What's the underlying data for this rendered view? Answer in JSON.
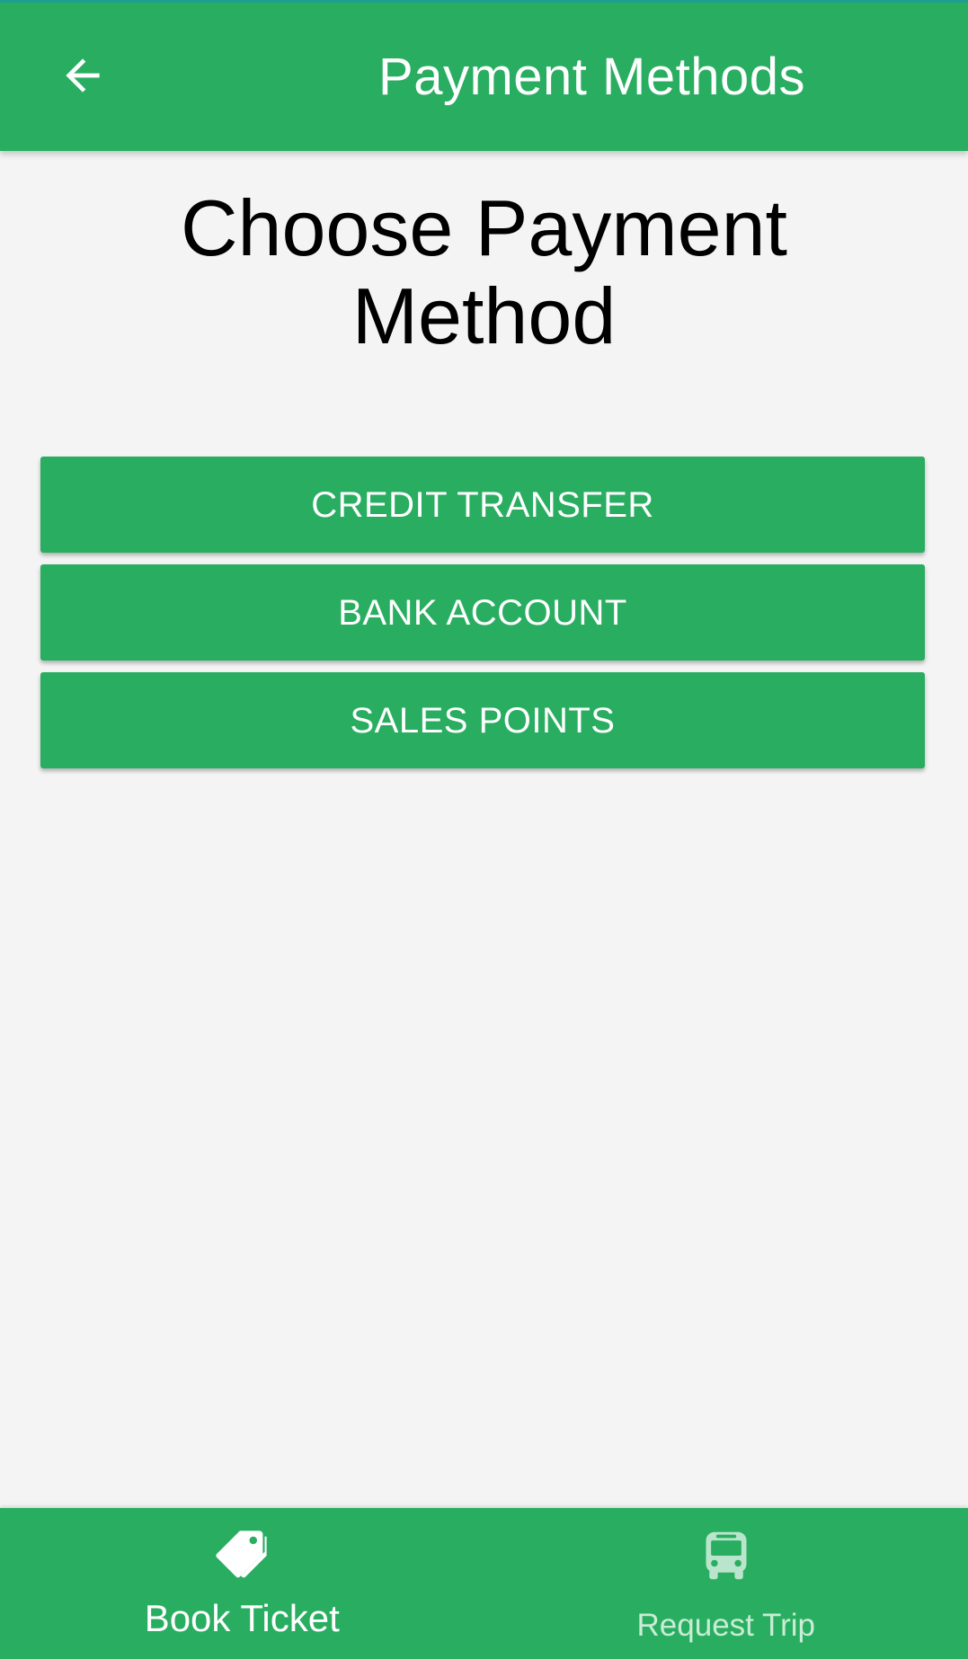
{
  "app_bar": {
    "title": "Payment Methods",
    "back_icon": "arrow-left-icon"
  },
  "main": {
    "heading": "Choose Payment Method",
    "buttons": [
      {
        "label": "CREDIT TRANSFER"
      },
      {
        "label": "BANK ACCOUNT"
      },
      {
        "label": "SALES POINTS"
      }
    ]
  },
  "bottom_nav": {
    "items": [
      {
        "label": "Book Ticket",
        "icon": "tags-icon",
        "active": true
      },
      {
        "label": "Request Trip",
        "icon": "bus-icon",
        "active": false
      }
    ]
  },
  "colors": {
    "primary": "#29ae61",
    "background": "#f4f4f4",
    "text_dark": "#000000",
    "text_light": "#ffffff"
  }
}
